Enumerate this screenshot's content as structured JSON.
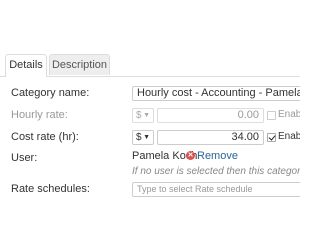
{
  "tabs": {
    "details": "Details",
    "description": "Description"
  },
  "form": {
    "category_name": {
      "label": "Category name:",
      "value": "Hourly cost - Accounting - Pamela Koch"
    },
    "hourly_rate": {
      "label": "Hourly rate:",
      "currency": "$",
      "value": "0.00",
      "enable_label": "Enable",
      "enabled": false
    },
    "cost_rate": {
      "label": "Cost rate (hr):",
      "currency": "$",
      "value": "34.00",
      "enable_label": "Enable",
      "enabled": true
    },
    "user": {
      "label": "User:",
      "name": "Pamela Koch",
      "remove_label": "Remove",
      "help_text": "If no user is selected then this category will a"
    },
    "rate_schedules": {
      "label": "Rate schedules:",
      "placeholder": "Type to select Rate schedule"
    }
  },
  "icons": {
    "remove": "remove-icon",
    "caret": "chevron-down-icon",
    "check": "check-icon"
  },
  "colors": {
    "remove_icon": "#d9534f",
    "link": "#2a6496"
  }
}
